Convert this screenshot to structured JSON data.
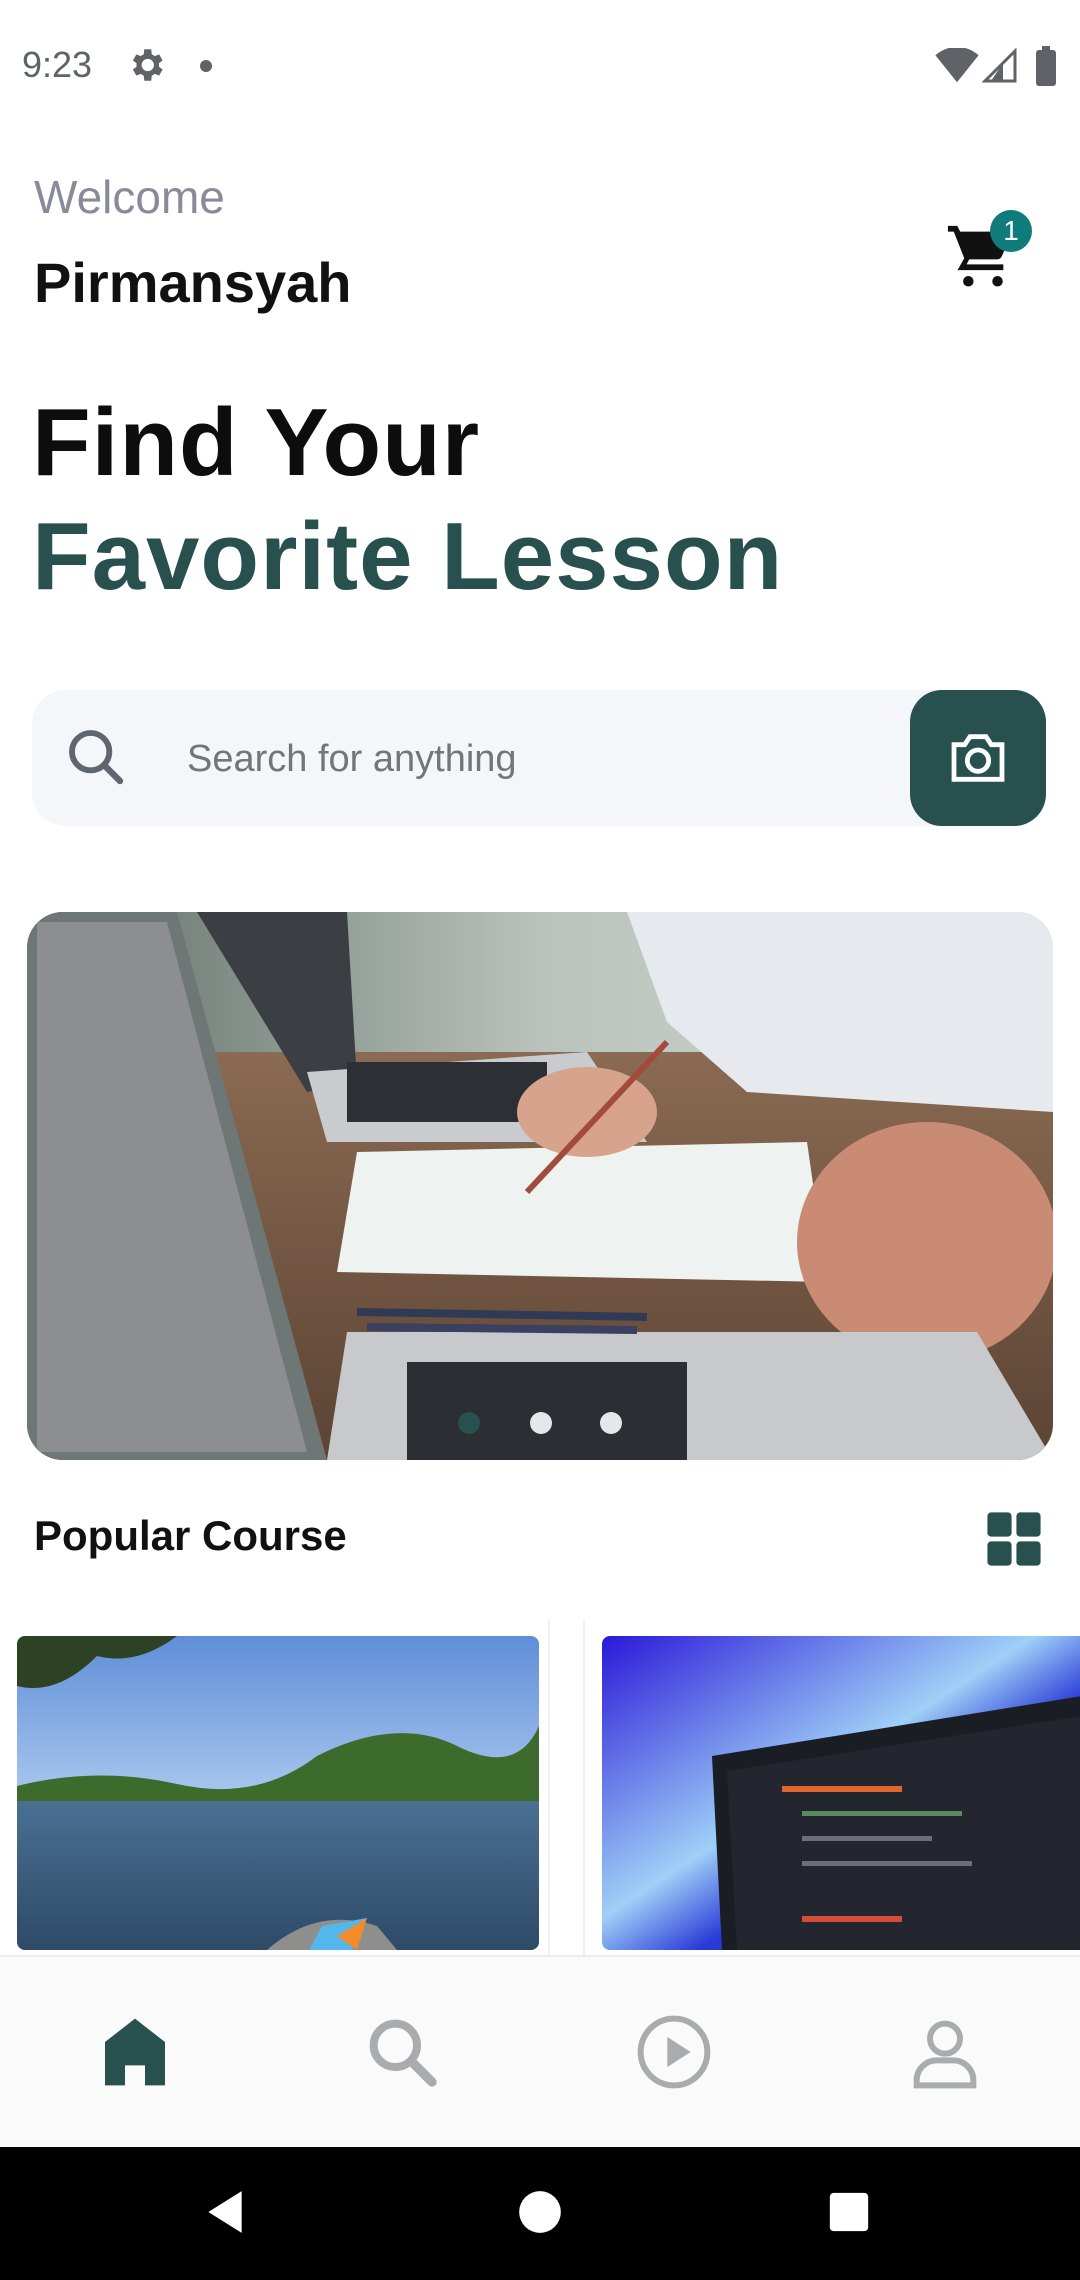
{
  "status_bar": {
    "time": "9:23",
    "icons": [
      "gear-icon",
      "dot-icon",
      "wifi-icon",
      "signal-icon",
      "battery-icon"
    ]
  },
  "header": {
    "welcome_label": "Welcome",
    "user_name": "Pirmansyah",
    "cart_count": "1"
  },
  "hero": {
    "line1": "Find Your",
    "line2": "Favorite Lesson"
  },
  "search": {
    "placeholder": "Search for anything",
    "value": ""
  },
  "banner": {
    "active_index": 0,
    "slide_count": 3
  },
  "popular": {
    "title": "Popular Course"
  },
  "bottom_nav": {
    "items": [
      "home-icon",
      "search-icon",
      "play-icon",
      "profile-icon"
    ],
    "active": "home-icon"
  },
  "colors": {
    "primary": "#27504f",
    "badge": "#0f7b7b",
    "search_bg": "#f4f6f9",
    "muted_text": "#8a8a9a"
  }
}
